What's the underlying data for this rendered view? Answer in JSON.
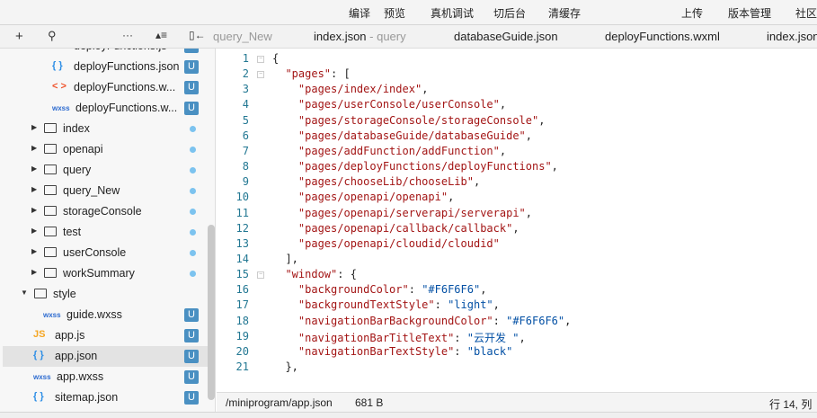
{
  "toolbar": {
    "compile": "编译",
    "preview": "预览",
    "remote_debug": "真机调试",
    "background": "切后台",
    "clear_cache": "清缓存",
    "upload": "上传",
    "version": "版本管理",
    "community": "社区"
  },
  "tabs": [
    {
      "label": "query_New",
      "sub": ""
    },
    {
      "label": "index.json",
      "sub": " - query"
    },
    {
      "label": "databaseGuide.json",
      "sub": ""
    },
    {
      "label": "deployFunctions.wxml",
      "sub": ""
    },
    {
      "label": "index.json",
      "sub": ""
    }
  ],
  "sidebar": {
    "items": [
      {
        "label": "deployFunctions.js",
        "icon": "JS",
        "type": "js",
        "indent": 2,
        "badge": "U"
      },
      {
        "label": "deployFunctions.json",
        "icon": "{ }",
        "type": "json",
        "indent": 2,
        "badge": "U"
      },
      {
        "label": "deployFunctions.w...",
        "icon": "< >",
        "type": "wxml",
        "indent": 2,
        "badge": "U"
      },
      {
        "label": "deployFunctions.w...",
        "icon": "wxss",
        "type": "wxss",
        "indent": 2,
        "badge": "U"
      },
      {
        "label": "index",
        "type": "folder",
        "indent": 1,
        "dot": true
      },
      {
        "label": "openapi",
        "type": "folder",
        "indent": 1,
        "dot": true
      },
      {
        "label": "query",
        "type": "folder",
        "indent": 1,
        "dot": true
      },
      {
        "label": "query_New",
        "type": "folder",
        "indent": 1,
        "dot": true
      },
      {
        "label": "storageConsole",
        "type": "folder",
        "indent": 1,
        "dot": true
      },
      {
        "label": "test",
        "type": "folder",
        "indent": 1,
        "dot": true
      },
      {
        "label": "userConsole",
        "type": "folder",
        "indent": 1,
        "dot": true
      },
      {
        "label": "workSummary",
        "type": "folder",
        "indent": 1,
        "dot": true
      },
      {
        "label": "style",
        "type": "folder-open",
        "indent": 0
      },
      {
        "label": "guide.wxss",
        "icon": "wxss",
        "type": "wxss",
        "indent": 1,
        "badge": "U"
      },
      {
        "label": "app.js",
        "icon": "JS",
        "type": "js",
        "indent": 0,
        "badge": "U"
      },
      {
        "label": "app.json",
        "icon": "{ }",
        "type": "json",
        "indent": 0,
        "badge": "U",
        "selected": true
      },
      {
        "label": "app.wxss",
        "icon": "wxss",
        "type": "wxss",
        "indent": 0,
        "badge": "U"
      },
      {
        "label": "sitemap.json",
        "icon": "{ }",
        "type": "json",
        "indent": 0,
        "badge": "U"
      }
    ]
  },
  "editor": {
    "lines": [
      [
        [
          "{",
          "p"
        ]
      ],
      [
        [
          "  ",
          "p"
        ],
        [
          "\"pages\"",
          "k"
        ],
        [
          ": [",
          "p"
        ]
      ],
      [
        [
          "    ",
          "p"
        ],
        [
          "\"pages/index/index\"",
          "k"
        ],
        [
          ",",
          "p"
        ]
      ],
      [
        [
          "    ",
          "p"
        ],
        [
          "\"pages/userConsole/userConsole\"",
          "k"
        ],
        [
          ",",
          "p"
        ]
      ],
      [
        [
          "    ",
          "p"
        ],
        [
          "\"pages/storageConsole/storageConsole\"",
          "k"
        ],
        [
          ",",
          "p"
        ]
      ],
      [
        [
          "    ",
          "p"
        ],
        [
          "\"pages/databaseGuide/databaseGuide\"",
          "k"
        ],
        [
          ",",
          "p"
        ]
      ],
      [
        [
          "    ",
          "p"
        ],
        [
          "\"pages/addFunction/addFunction\"",
          "k"
        ],
        [
          ",",
          "p"
        ]
      ],
      [
        [
          "    ",
          "p"
        ],
        [
          "\"pages/deployFunctions/deployFunctions\"",
          "k"
        ],
        [
          ",",
          "p"
        ]
      ],
      [
        [
          "    ",
          "p"
        ],
        [
          "\"pages/chooseLib/chooseLib\"",
          "k"
        ],
        [
          ",",
          "p"
        ]
      ],
      [
        [
          "    ",
          "p"
        ],
        [
          "\"pages/openapi/openapi\"",
          "k"
        ],
        [
          ",",
          "p"
        ]
      ],
      [
        [
          "    ",
          "p"
        ],
        [
          "\"pages/openapi/serverapi/serverapi\"",
          "k"
        ],
        [
          ",",
          "p"
        ]
      ],
      [
        [
          "    ",
          "p"
        ],
        [
          "\"pages/openapi/callback/callback\"",
          "k"
        ],
        [
          ",",
          "p"
        ]
      ],
      [
        [
          "    ",
          "p"
        ],
        [
          "\"pages/openapi/cloudid/cloudid\"",
          "k"
        ]
      ],
      [
        [
          "  ],",
          "p"
        ]
      ],
      [
        [
          "  ",
          "p"
        ],
        [
          "\"window\"",
          "k"
        ],
        [
          ": {",
          "p"
        ]
      ],
      [
        [
          "    ",
          "p"
        ],
        [
          "\"backgroundColor\"",
          "k"
        ],
        [
          ": ",
          "p"
        ],
        [
          "\"#F6F6F6\"",
          "v"
        ],
        [
          ",",
          "p"
        ]
      ],
      [
        [
          "    ",
          "p"
        ],
        [
          "\"backgroundTextStyle\"",
          "k"
        ],
        [
          ": ",
          "p"
        ],
        [
          "\"light\"",
          "v"
        ],
        [
          ",",
          "p"
        ]
      ],
      [
        [
          "    ",
          "p"
        ],
        [
          "\"navigationBarBackgroundColor\"",
          "k"
        ],
        [
          ": ",
          "p"
        ],
        [
          "\"#F6F6F6\"",
          "v"
        ],
        [
          ",",
          "p"
        ]
      ],
      [
        [
          "    ",
          "p"
        ],
        [
          "\"navigationBarTitleText\"",
          "k"
        ],
        [
          ": ",
          "p"
        ],
        [
          "\"云开发 \"",
          "v"
        ],
        [
          ",",
          "p"
        ]
      ],
      [
        [
          "    ",
          "p"
        ],
        [
          "\"navigationBarTextStyle\"",
          "k"
        ],
        [
          ": ",
          "p"
        ],
        [
          "\"black\"",
          "v"
        ]
      ],
      [
        [
          "  },",
          "p"
        ]
      ]
    ]
  },
  "status": {
    "path": "/miniprogram/app.json",
    "size": "681 B",
    "position": "行 14, 列"
  }
}
